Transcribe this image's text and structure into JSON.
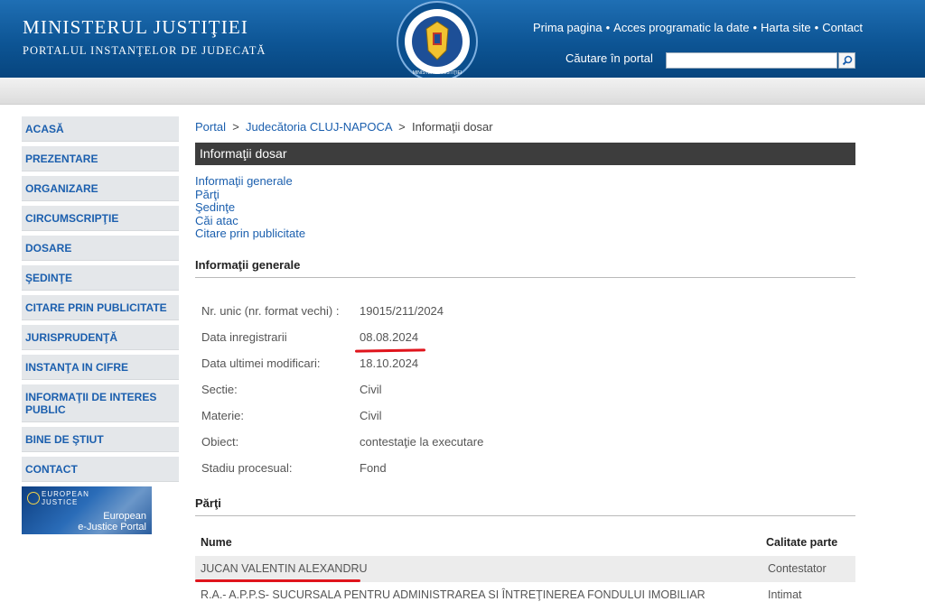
{
  "header": {
    "title": "MINISTERUL JUSTIŢIEI",
    "subtitle": "PORTALUL INSTANŢELOR DE JUDECATĂ",
    "emblem_top_text": "ROMÂNIA",
    "emblem_bottom_text": "MINISTERUL JUSTIŢIEI",
    "nav": [
      "Prima pagina",
      "Acces programatic la date",
      "Harta site",
      "Contact"
    ],
    "search_label": "Căutare în portal",
    "search_value": ""
  },
  "sidebar": {
    "items": [
      "ACASĂ",
      "PREZENTARE",
      "ORGANIZARE",
      "CIRCUMSCRIPŢIE",
      "DOSARE",
      "ŞEDINŢE",
      "CITARE PRIN PUBLICITATE",
      "JURISPRUDENŢĂ",
      "INSTANŢA IN CIFRE",
      "INFORMAŢII DE INTERES PUBLIC",
      "BINE DE ŞTIUT",
      "CONTACT"
    ],
    "ejustice": {
      "top": "EUROPEAN\nJUSTICE",
      "line1": "European",
      "line2": "e-Justice Portal"
    }
  },
  "breadcrumb": {
    "home": "Portal",
    "court": "Judecătoria CLUJ-NAPOCA",
    "current": "Informaţii dosar"
  },
  "section_title": "Informaţii dosar",
  "links": [
    "Informaţii generale",
    "Părţi",
    "Şedinţe",
    "Căi atac",
    "Citare prin publicitate"
  ],
  "general": {
    "title": "Informaţii generale",
    "rows": [
      {
        "k": "Nr. unic (nr. format vechi) :",
        "v": "19015/211/2024"
      },
      {
        "k": "Data inregistrarii",
        "v": "08.08.2024"
      },
      {
        "k": "Data ultimei modificari:",
        "v": "18.10.2024"
      },
      {
        "k": "Sectie:",
        "v": "Civil"
      },
      {
        "k": "Materie:",
        "v": "Civil"
      },
      {
        "k": "Obiect:",
        "v": "contestaţie la executare"
      },
      {
        "k": "Stadiu procesual:",
        "v": "Fond"
      }
    ]
  },
  "parties": {
    "title": "Părţi",
    "col_name": "Nume",
    "col_role": "Calitate parte",
    "rows": [
      {
        "name": "JUCAN VALENTIN ALEXANDRU",
        "role": "Contestator"
      },
      {
        "name": "R.A.- A.P.P.S- SUCURSALA PENTRU ADMINISTRAREA SI ÎNTREŢINEREA FONDULUI IMOBILIAR",
        "role": "Intimat"
      }
    ]
  },
  "colors": {
    "header_blue": "#0d5595",
    "link_blue": "#1b5fae",
    "highlight_red": "#e0141c",
    "section_dark": "#3d3d3d"
  }
}
